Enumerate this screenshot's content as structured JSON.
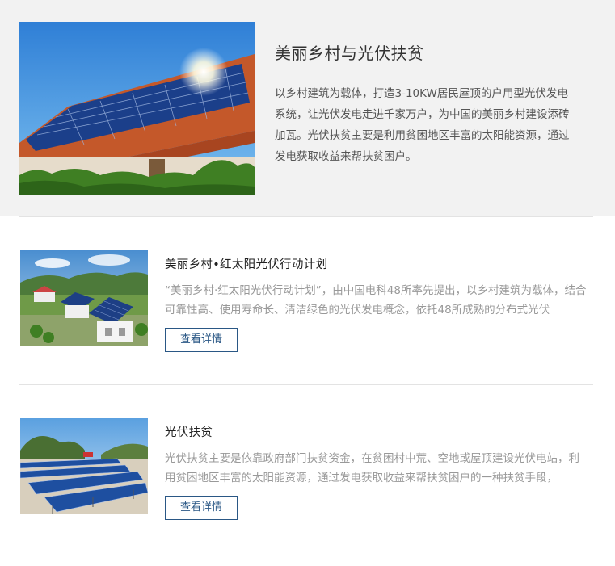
{
  "hero": {
    "title": "美丽乡村与光伏扶贫",
    "description": "以乡村建筑为载体，打造3-10KW居民屋顶的户用型光伏发电系统，让光伏发电走进千家万户，为中国的美丽乡村建设添砖加瓦。光伏扶贫主要是利用贫困地区丰富的太阳能资源，通过发电获取收益来帮扶贫困户。"
  },
  "cards": [
    {
      "title": "美丽乡村•红太阳光伏行动计划",
      "description": "“美丽乡村·红太阳光伏行动计划”，由中国电科48所率先提出，以乡村建筑为载体，结合可靠性高、使用寿命长、清洁绿色的光伏发电概念，依托48所成熟的分布式光伏",
      "button_label": "查看详情"
    },
    {
      "title": "光伏扶贫",
      "description": "光伏扶贫主要是依靠政府部门扶贫资金，在贫困村中荒、空地或屋顶建设光伏电站，利用贫困地区丰富的太阳能资源，通过发电获取收益来帮扶贫困户的一种扶贫手段，",
      "button_label": "查看详情"
    }
  ]
}
